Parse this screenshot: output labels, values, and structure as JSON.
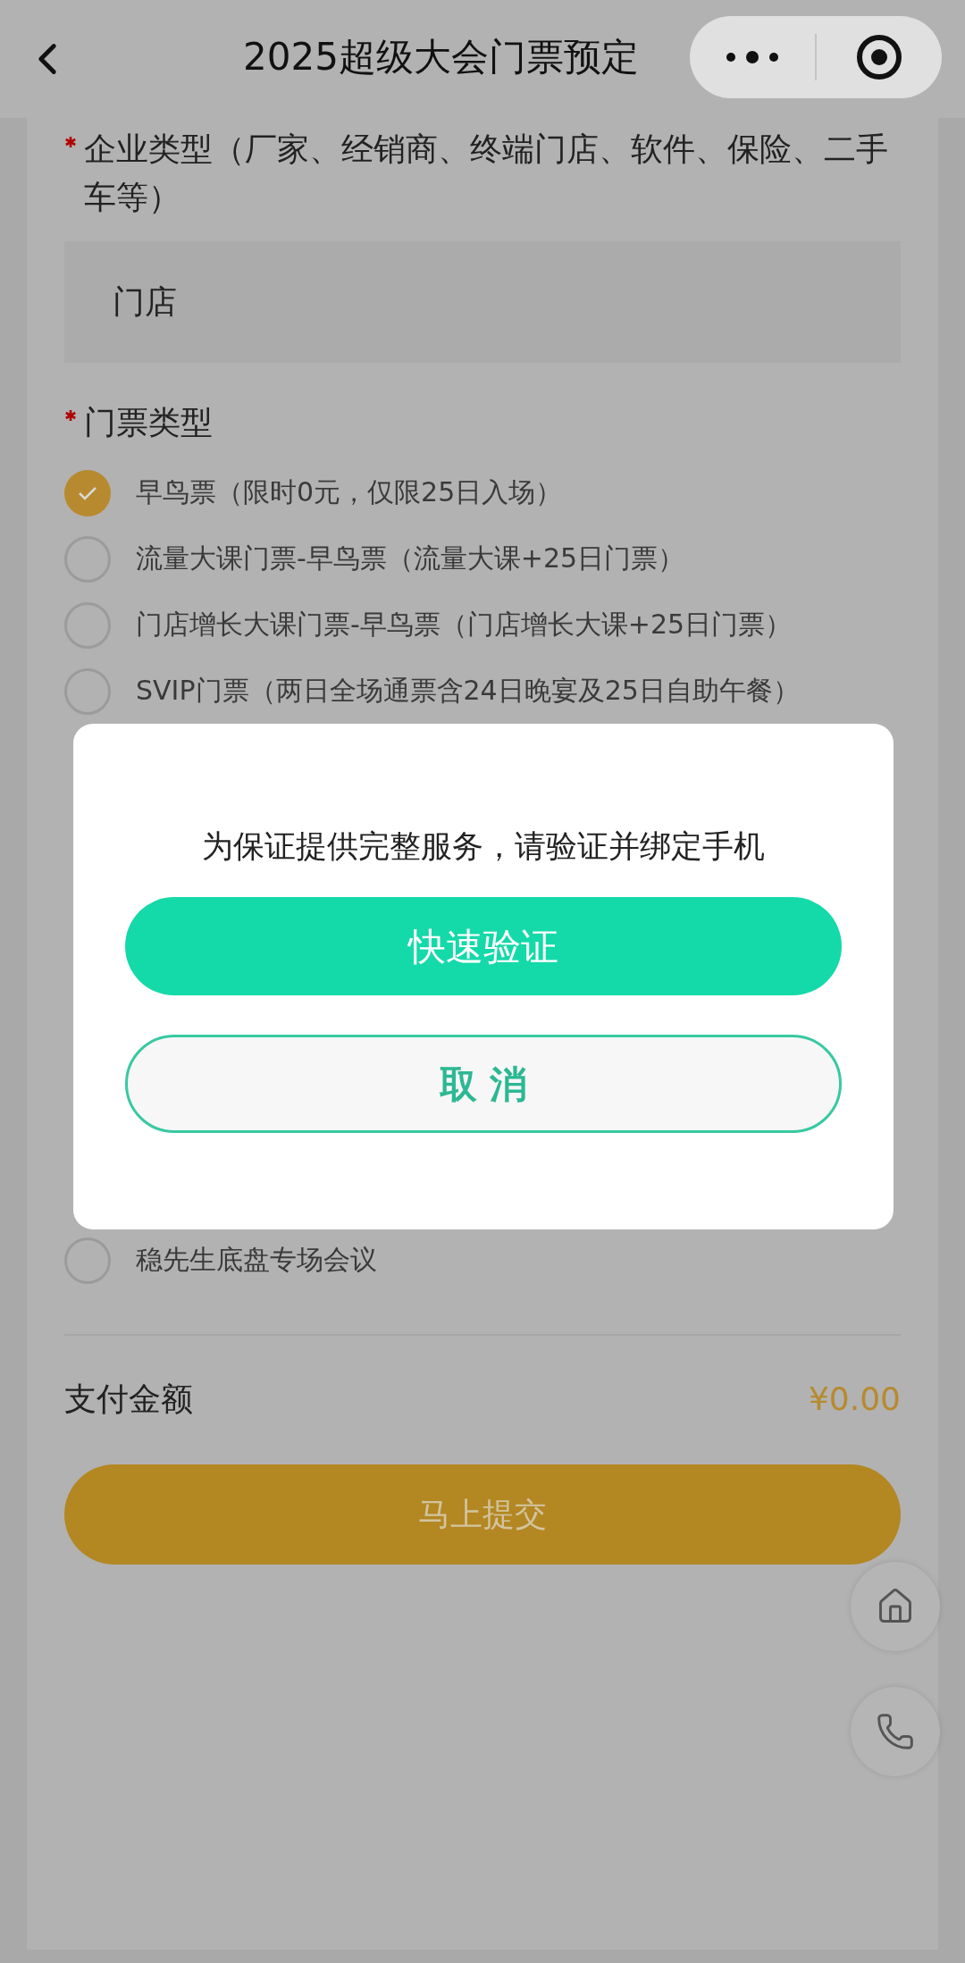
{
  "header": {
    "title": "2025超级大会门票预定"
  },
  "company_type": {
    "label": "企业类型（厂家、经销商、终端门店、软件、保险、二手车等）",
    "required": true,
    "value": "门店"
  },
  "ticket_type": {
    "label": "门票类型",
    "required": true,
    "options": [
      {
        "label": "早鸟票（限时0元，仅限25日入场）",
        "selected": true
      },
      {
        "label": "流量大课门票-早鸟票（流量大课+25日门票）",
        "selected": false
      },
      {
        "label": "门店增长大课门票-早鸟票（门店增长大课+25日门票）",
        "selected": false
      },
      {
        "label": "SVIP门票（两日全场通票含24日晚宴及25日自助午餐）",
        "selected": false
      }
    ]
  },
  "sessions": {
    "options": [
      {
        "label": "稳先生底盘专场会议",
        "selected": false
      }
    ]
  },
  "payment": {
    "label": "支付金额",
    "amount": "¥0.00"
  },
  "submit_button": "马上提交",
  "dialog": {
    "message": "为保证提供完整服务，请验证并绑定手机",
    "confirm_button": "快速验证",
    "cancel_button": "取 消"
  }
}
